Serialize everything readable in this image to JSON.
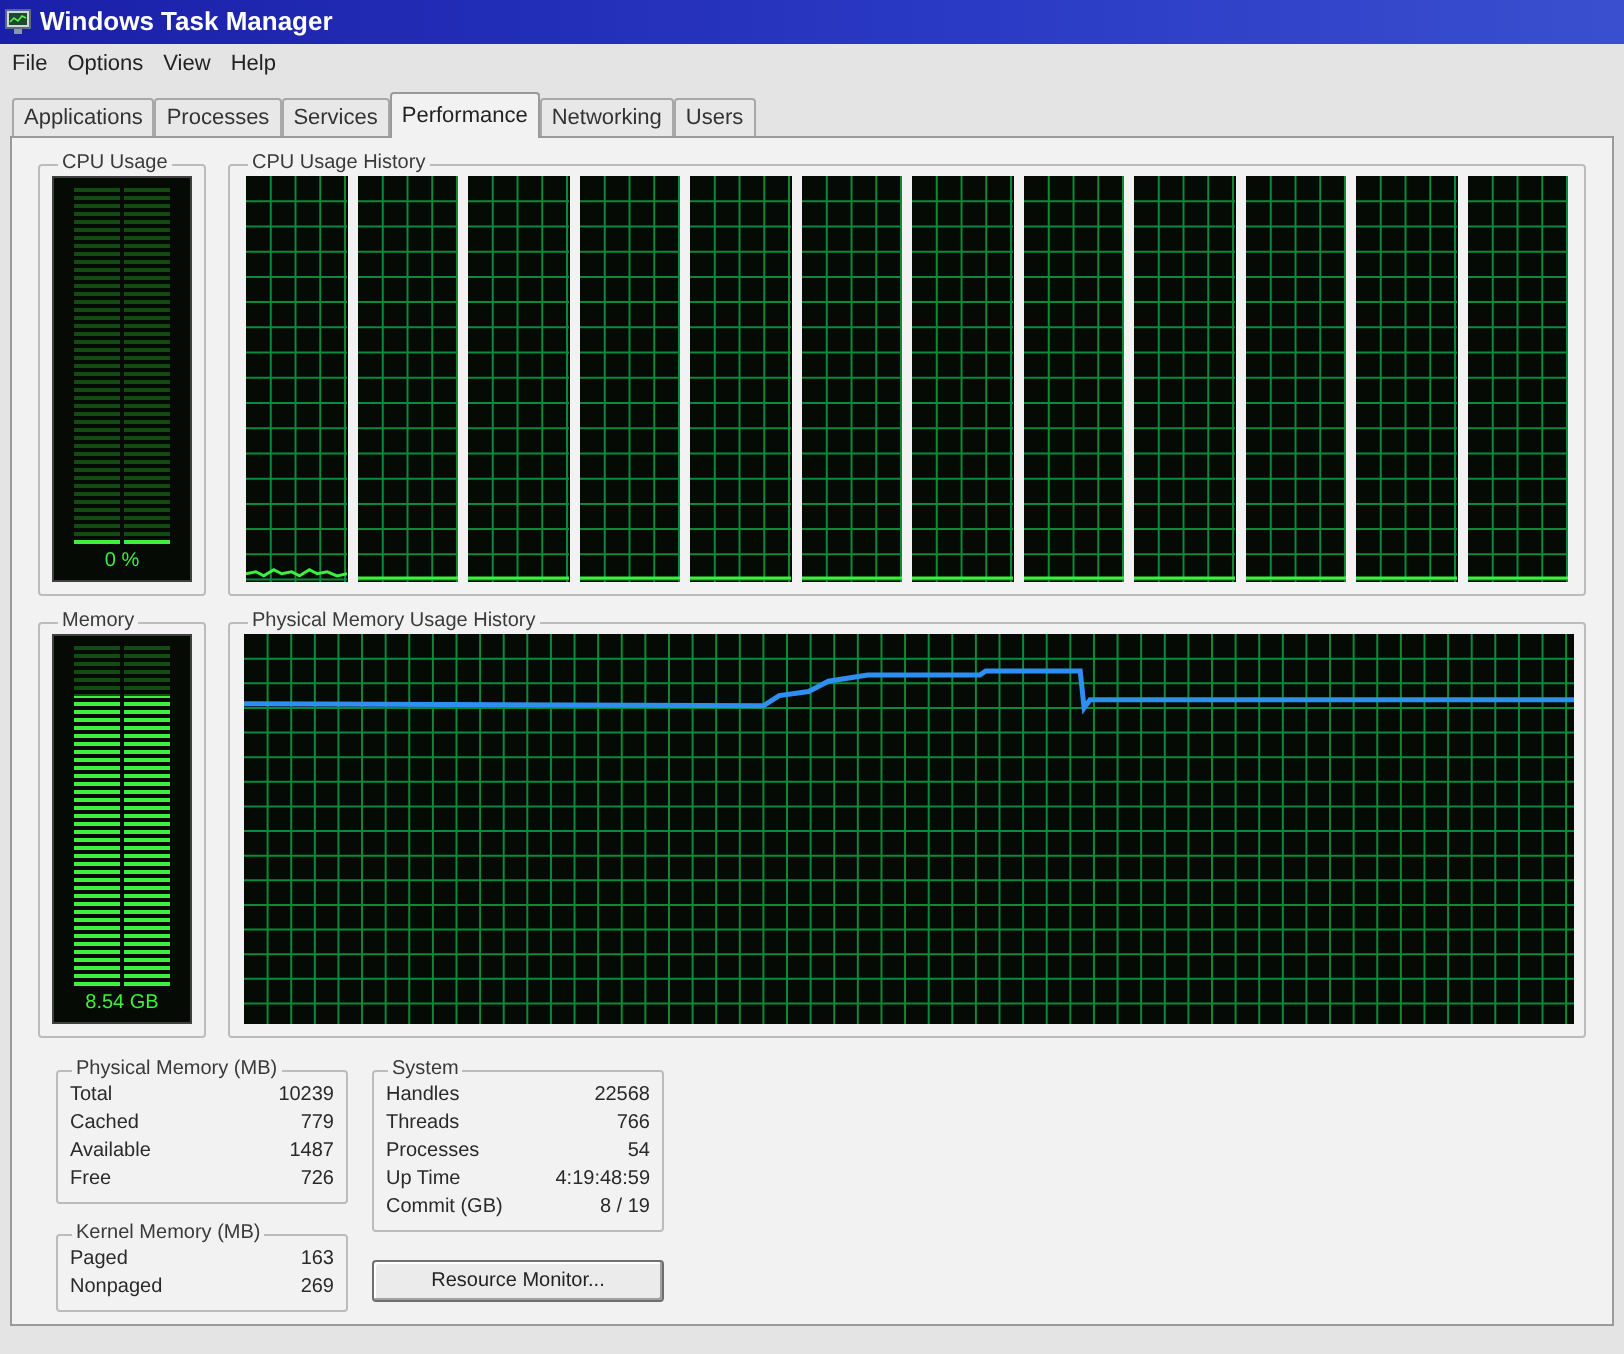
{
  "window": {
    "title": "Windows Task Manager"
  },
  "menu": [
    "File",
    "Options",
    "View",
    "Help"
  ],
  "tabs": [
    {
      "label": "Applications",
      "selected": false
    },
    {
      "label": "Processes",
      "selected": false
    },
    {
      "label": "Services",
      "selected": false
    },
    {
      "label": "Performance",
      "selected": true
    },
    {
      "label": "Networking",
      "selected": false
    },
    {
      "label": "Users",
      "selected": false
    }
  ],
  "cpu_usage": {
    "title": "CPU Usage",
    "reading": "0 %",
    "level": 0
  },
  "cpu_history": {
    "title": "CPU Usage History"
  },
  "memory": {
    "title": "Memory",
    "reading": "8.54 GB",
    "level": 0.85
  },
  "memory_history": {
    "title": "Physical Memory Usage History"
  },
  "physical_memory": {
    "title": "Physical Memory (MB)",
    "rows": [
      {
        "label": "Total",
        "value": "10239"
      },
      {
        "label": "Cached",
        "value": "779"
      },
      {
        "label": "Available",
        "value": "1487"
      },
      {
        "label": "Free",
        "value": "726"
      }
    ]
  },
  "kernel_memory": {
    "title": "Kernel Memory (MB)",
    "rows": [
      {
        "label": "Paged",
        "value": "163"
      },
      {
        "label": "Nonpaged",
        "value": "269"
      }
    ]
  },
  "system": {
    "title": "System",
    "rows": [
      {
        "label": "Handles",
        "value": "22568"
      },
      {
        "label": "Threads",
        "value": "766"
      },
      {
        "label": "Processes",
        "value": "54"
      },
      {
        "label": "Up Time",
        "value": "4:19:48:59"
      },
      {
        "label": "Commit (GB)",
        "value": "8 / 19"
      }
    ]
  },
  "buttons": [
    "Resource Monitor..."
  ]
}
